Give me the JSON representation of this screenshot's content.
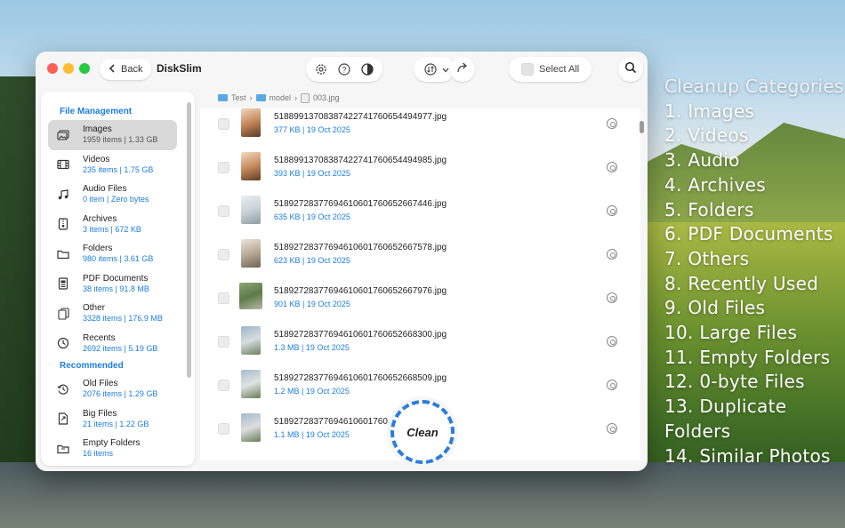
{
  "app": {
    "title": "DiskSlim",
    "back_label": "Back"
  },
  "toolbar": {
    "select_all_label": "Select All"
  },
  "sidebar": {
    "sections": [
      {
        "title": "File Management",
        "items": [
          {
            "label": "Images",
            "meta": "1959 items | 1.33 GB",
            "icon": "images-icon",
            "selected": true
          },
          {
            "label": "Videos",
            "meta": "235 items | 1.75 GB",
            "icon": "film-icon"
          },
          {
            "label": "Audio Files",
            "meta": "0 item | Zero bytes",
            "icon": "music-note-icon"
          },
          {
            "label": "Archives",
            "meta": "3 items | 672 KB",
            "icon": "archive-icon"
          },
          {
            "label": "Folders",
            "meta": "980 items | 3.61 GB",
            "icon": "folder-icon"
          },
          {
            "label": "PDF Documents",
            "meta": "38 items | 91.8 MB",
            "icon": "document-icon"
          },
          {
            "label": "Other",
            "meta": "3328 items | 176.9 MB",
            "icon": "files-icon"
          },
          {
            "label": "Recents",
            "meta": "2692 items | 5.19 GB",
            "icon": "clock-icon"
          }
        ]
      },
      {
        "title": "Recommended",
        "items": [
          {
            "label": "Old Files",
            "meta": "2076 items | 1.29 GB",
            "icon": "history-icon"
          },
          {
            "label": "Big Files",
            "meta": "21 items | 1.22 GB",
            "icon": "big-file-icon"
          },
          {
            "label": "Empty Folders",
            "meta": "16 items",
            "icon": "empty-folder-icon"
          }
        ]
      }
    ]
  },
  "breadcrumb": [
    "Test",
    "model",
    "003.jpg"
  ],
  "files": [
    {
      "name": "51889913708387422741760654494977.jpg",
      "meta": "377 KB | 19 Oct 2025"
    },
    {
      "name": "51889913708387422741760654494985.jpg",
      "meta": "393 KB | 19 Oct 2025"
    },
    {
      "name": "51892728377694610601760652667446.jpg",
      "meta": "635 KB | 19 Oct 2025"
    },
    {
      "name": "51892728377694610601760652667578.jpg",
      "meta": "623 KB | 19 Oct 2025"
    },
    {
      "name": "51892728377694610601760652667976.jpg",
      "meta": "901 KB | 19 Oct 2025"
    },
    {
      "name": "51892728377694610601760652668300.jpg",
      "meta": "1.3 MB | 19 Oct 2025"
    },
    {
      "name": "51892728377694610601760652668509.jpg",
      "meta": "1.2 MB | 19 Oct 2025"
    },
    {
      "name": "51892728377694610601760",
      "meta": "1.1 MB | 19 Oct 2025"
    }
  ],
  "clean_label": "Clean",
  "categories": {
    "title": "Cleanup Categories",
    "items": [
      "1. Images",
      "2. Videos",
      "3. Audio",
      "4. Archives",
      "5. Folders",
      "6. PDF Documents",
      "7. Others",
      "8. Recently Used",
      "9. Old Files",
      "10. Large Files",
      "11. Empty Folders",
      "12. 0-byte Files",
      "13. Duplicate Folders",
      "14. Similar Photos"
    ]
  },
  "colors": {
    "accent": "#1d7ee0",
    "clean_ring": "#2b7ddf"
  }
}
